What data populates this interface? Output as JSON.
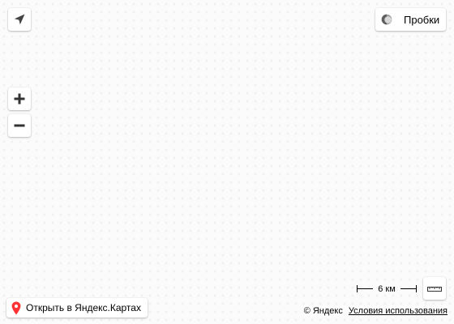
{
  "controls": {
    "geolocation_icon": "arrow-navigation-icon",
    "zoom_in_icon": "plus-icon",
    "zoom_out_icon": "minus-icon",
    "ruler_icon": "ruler-icon"
  },
  "traffic": {
    "label": "Пробки",
    "icon": "traffic-light-icon"
  },
  "open_link": {
    "label": "Открыть в Яндекс.Картах",
    "icon": "map-pin-icon",
    "pin_color": "#ff3333"
  },
  "scale": {
    "label": "6 км"
  },
  "attribution": {
    "copyright": "© Яндекс",
    "terms_label": "Условия использования"
  },
  "colors": {
    "map_background": "#fbfbfb",
    "control_background": "#ffffff"
  }
}
